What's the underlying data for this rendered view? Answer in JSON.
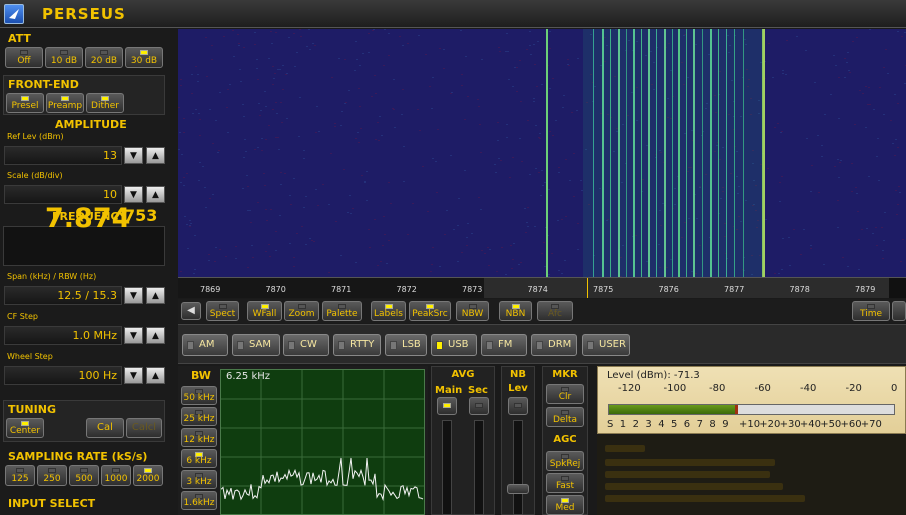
{
  "app": {
    "title": "PERSEUS"
  },
  "att": {
    "title": "ATT",
    "buttons": [
      {
        "label": "Off",
        "on": false
      },
      {
        "label": "10 dB",
        "on": false
      },
      {
        "label": "20 dB",
        "on": false
      },
      {
        "label": "30 dB",
        "on": true
      }
    ]
  },
  "frontend": {
    "title": "FRONT-END",
    "buttons": [
      {
        "label": "Presel",
        "on": true
      },
      {
        "label": "Preamp",
        "on": true
      },
      {
        "label": "Dither",
        "on": true
      }
    ]
  },
  "amplitude": {
    "title": "AMPLITUDE",
    "ref_label": "Ref Lev (dBm)",
    "ref_value": "13",
    "scale_label": "Scale (dB/div)",
    "scale_value": "10"
  },
  "frequency": {
    "title": "FREQUENCY",
    "main": "7.874",
    "small": "753",
    "span_label": "Span (kHz) / RBW (Hz)",
    "span_value": "12.5 / 15.3",
    "cfstep_label": "CF Step",
    "cfstep_value": "1.0 MHz",
    "wheel_label": "Wheel Step",
    "wheel_value": "100 Hz"
  },
  "tuning": {
    "title": "TUNING",
    "center_label": "Center",
    "cal_label": "Cal",
    "calcl_label": "Calcl"
  },
  "sampling": {
    "title": "SAMPLING RATE (kS/s)",
    "buttons": [
      {
        "label": "125",
        "on": false
      },
      {
        "label": "250",
        "on": false
      },
      {
        "label": "500",
        "on": false
      },
      {
        "label": "1000",
        "on": false
      },
      {
        "label": "2000",
        "on": true
      }
    ]
  },
  "input": {
    "title": "INPUT SELECT"
  },
  "scale_ticks": [
    "7869",
    "7870",
    "7871",
    "7872",
    "7873",
    "7874",
    "7875",
    "7876",
    "7877",
    "7878",
    "7879"
  ],
  "toolbar": {
    "buttons": [
      {
        "label": "Spect",
        "on": false
      },
      {
        "label": "WFall",
        "on": true
      },
      {
        "label": "Zoom",
        "on": false
      },
      {
        "label": "Palette",
        "on": false
      },
      {
        "label": "Labels",
        "on": true
      },
      {
        "label": "PeakSrc",
        "on": true
      },
      {
        "label": "NBW",
        "on": false
      },
      {
        "label": "NBN",
        "on": true
      },
      {
        "label": "Afc",
        "on": false
      }
    ],
    "time_label": "Time",
    "arrow_left": "◀"
  },
  "modes": [
    {
      "label": "AM",
      "on": false
    },
    {
      "label": "SAM",
      "on": false
    },
    {
      "label": "CW",
      "on": false
    },
    {
      "label": "RTTY",
      "on": false
    },
    {
      "label": "LSB",
      "on": false
    },
    {
      "label": "USB",
      "on": true
    },
    {
      "label": "FM",
      "on": false
    },
    {
      "label": "DRM",
      "on": false
    },
    {
      "label": "USER",
      "on": false
    }
  ],
  "bw": {
    "title": "BW",
    "value": "6.25 kHz",
    "buttons": [
      {
        "label": "50 kHz",
        "on": false
      },
      {
        "label": "25 kHz",
        "on": false
      },
      {
        "label": "12 kHz",
        "on": false
      },
      {
        "label": "6 kHz",
        "on": true
      },
      {
        "label": "3 kHz",
        "on": false
      },
      {
        "label": "1.6kHz",
        "on": false
      }
    ]
  },
  "avg": {
    "title": "AVG",
    "main_label": "Main",
    "sec_label": "Sec"
  },
  "nb": {
    "title": "NB",
    "lev_label": "Lev"
  },
  "mkr": {
    "title": "MKR",
    "clr_label": "Clr",
    "delta_label": "Delta"
  },
  "agc": {
    "title": "AGC",
    "buttons": [
      {
        "label": "SpkRej",
        "on": false
      },
      {
        "label": "Fast",
        "on": false
      },
      {
        "label": "Med",
        "on": true
      }
    ]
  },
  "meter": {
    "label": "Level (dBm): -71.3",
    "top_scale": [
      "-120",
      "-100",
      "-80",
      "-60",
      "-40",
      "-20",
      "0"
    ],
    "bottom_scale": [
      "S",
      "1",
      "2",
      "3",
      "4",
      "5",
      "6",
      "7",
      "8",
      "9",
      "+10",
      "+20",
      "+30",
      "+40",
      "+50",
      "+60",
      "+70"
    ],
    "level_fraction": 0.44
  },
  "colors": {
    "accent": "#f2c200",
    "waterfall_bg": "#1e1c66",
    "signal": "#6cf0a0"
  }
}
